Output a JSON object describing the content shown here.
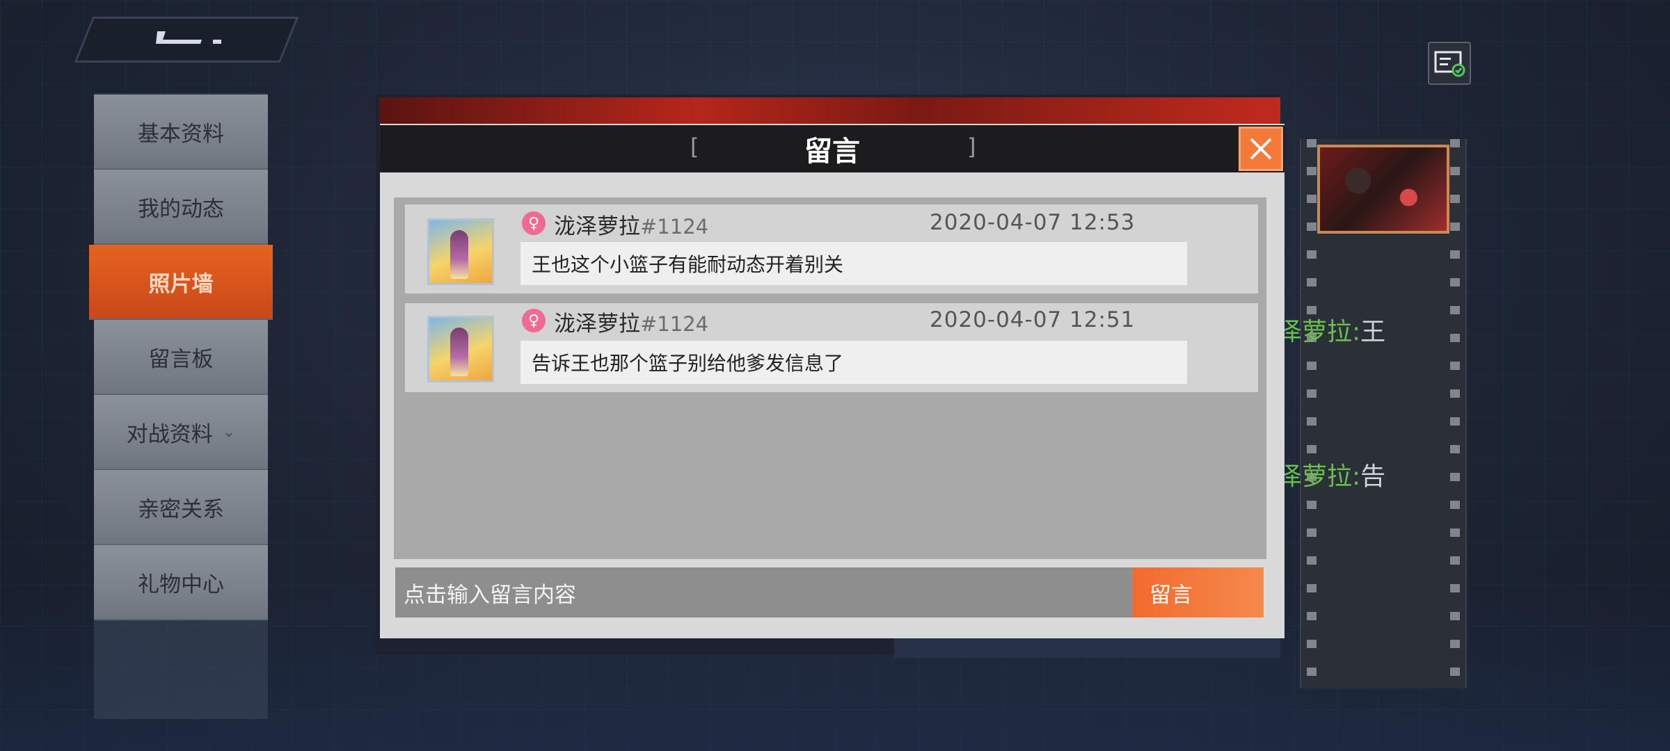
{
  "menu": {
    "items": [
      {
        "label": "基本资料"
      },
      {
        "label": "我的动态"
      },
      {
        "label": "照片墙"
      },
      {
        "label": "留言板"
      },
      {
        "label": "对战资料"
      },
      {
        "label": "亲密关系"
      },
      {
        "label": "礼物中心"
      }
    ],
    "active_index": 2
  },
  "background": {
    "comments": [
      {
        "name": "泽萝拉:",
        "text": "王"
      },
      {
        "name": "泽萝拉:",
        "text": "告"
      }
    ]
  },
  "modal": {
    "title": "留言",
    "bracket_left": "[",
    "bracket_right": "]",
    "messages": [
      {
        "username": "泷泽萝拉",
        "tag": "#1124",
        "time": "2020-04-07  12:53",
        "text": "王也这个小篮子有能耐动态开着别关"
      },
      {
        "username": "泷泽萝拉",
        "tag": "#1124",
        "time": "2020-04-07  12:51",
        "text": "告诉王也那个篮子别给他爹发信息了"
      }
    ],
    "input_placeholder": "点击输入留言内容",
    "send_label": "留言"
  },
  "colors": {
    "accent": "#f47a3a",
    "active_menu": "#e5631f",
    "gender_female": "#f06a92",
    "bg_comment_name": "#6ac04c"
  }
}
